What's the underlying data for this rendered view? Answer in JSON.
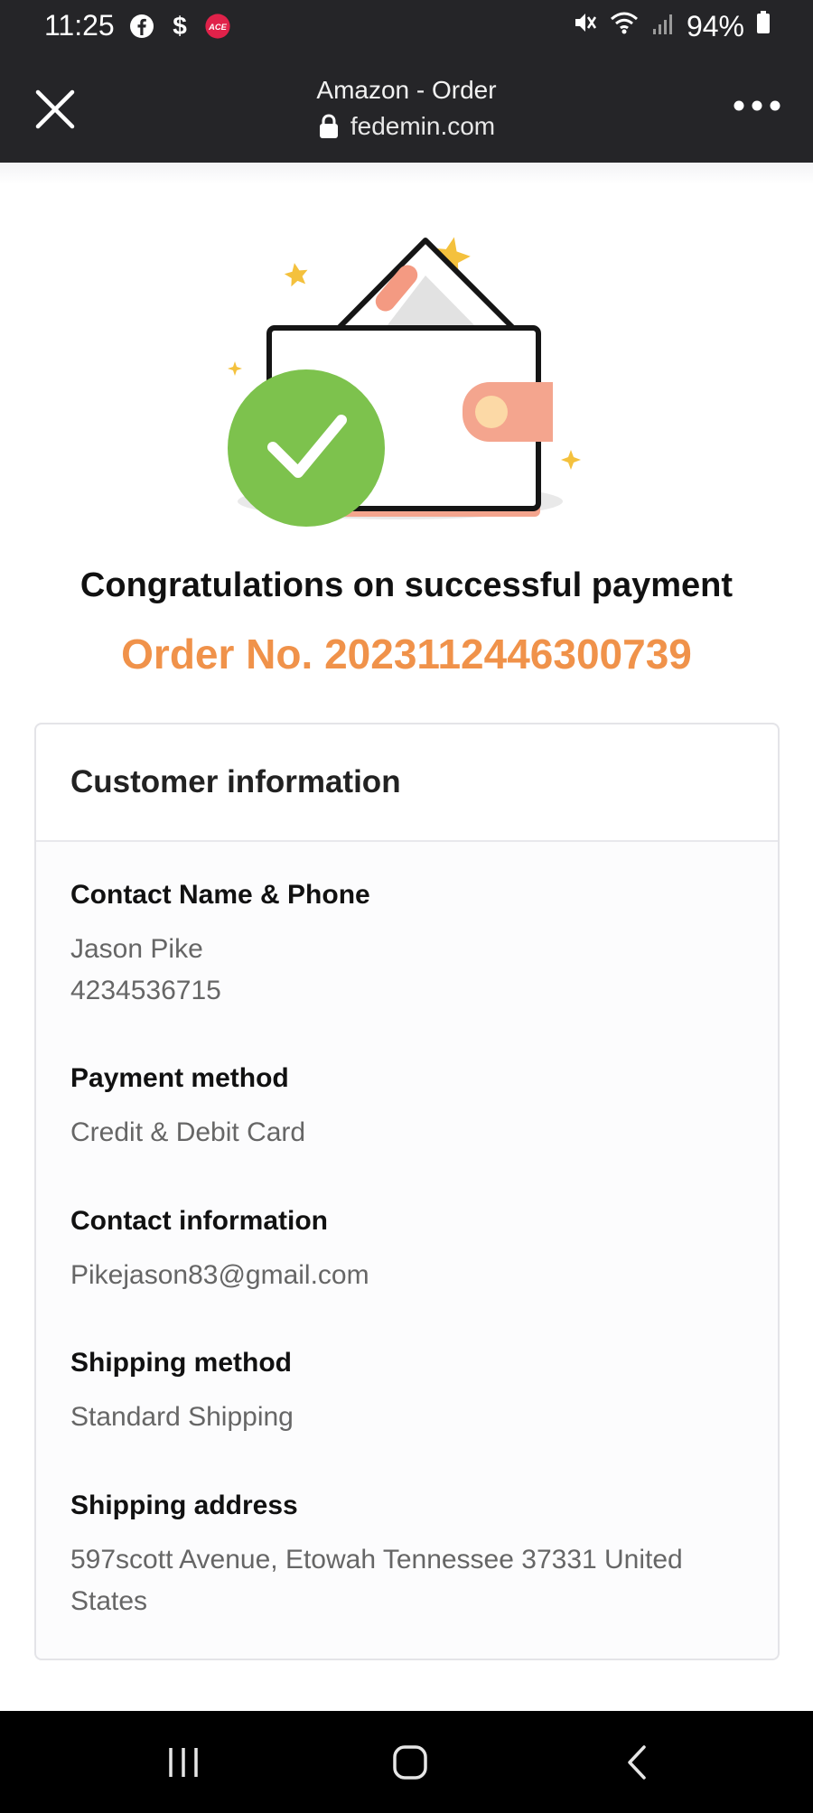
{
  "status_bar": {
    "time": "11:25",
    "battery": "94%",
    "left_icons": [
      "facebook-icon",
      "dollar-icon",
      "ace-app-icon"
    ],
    "ace_label": "ACE",
    "right_icons": [
      "mute-icon",
      "wifi-icon",
      "signal-icon",
      "battery-icon"
    ]
  },
  "browser": {
    "title": "Amazon - Order",
    "url": "fedemin.com"
  },
  "page": {
    "congrats": "Congratulations on successful payment",
    "order_no": "Order No. 2023112446300739"
  },
  "customer_info": {
    "title": "Customer information",
    "contact_label": "Contact Name & Phone",
    "contact_name": "Jason Pike",
    "contact_phone": "4234536715",
    "payment_label": "Payment method",
    "payment_value": "Credit & Debit Card",
    "contact_info_label": "Contact information",
    "contact_info_value": "Pikejason83@gmail.com",
    "shipping_method_label": "Shipping method",
    "shipping_method_value": "Standard Shipping",
    "shipping_address_label": "Shipping address",
    "shipping_address_value": "597scott Avenue, Etowah Tennessee 37331 United States"
  },
  "colors": {
    "accent_orange": "#f0924a",
    "success_green": "#7dc24d",
    "header_dark": "#252528"
  }
}
